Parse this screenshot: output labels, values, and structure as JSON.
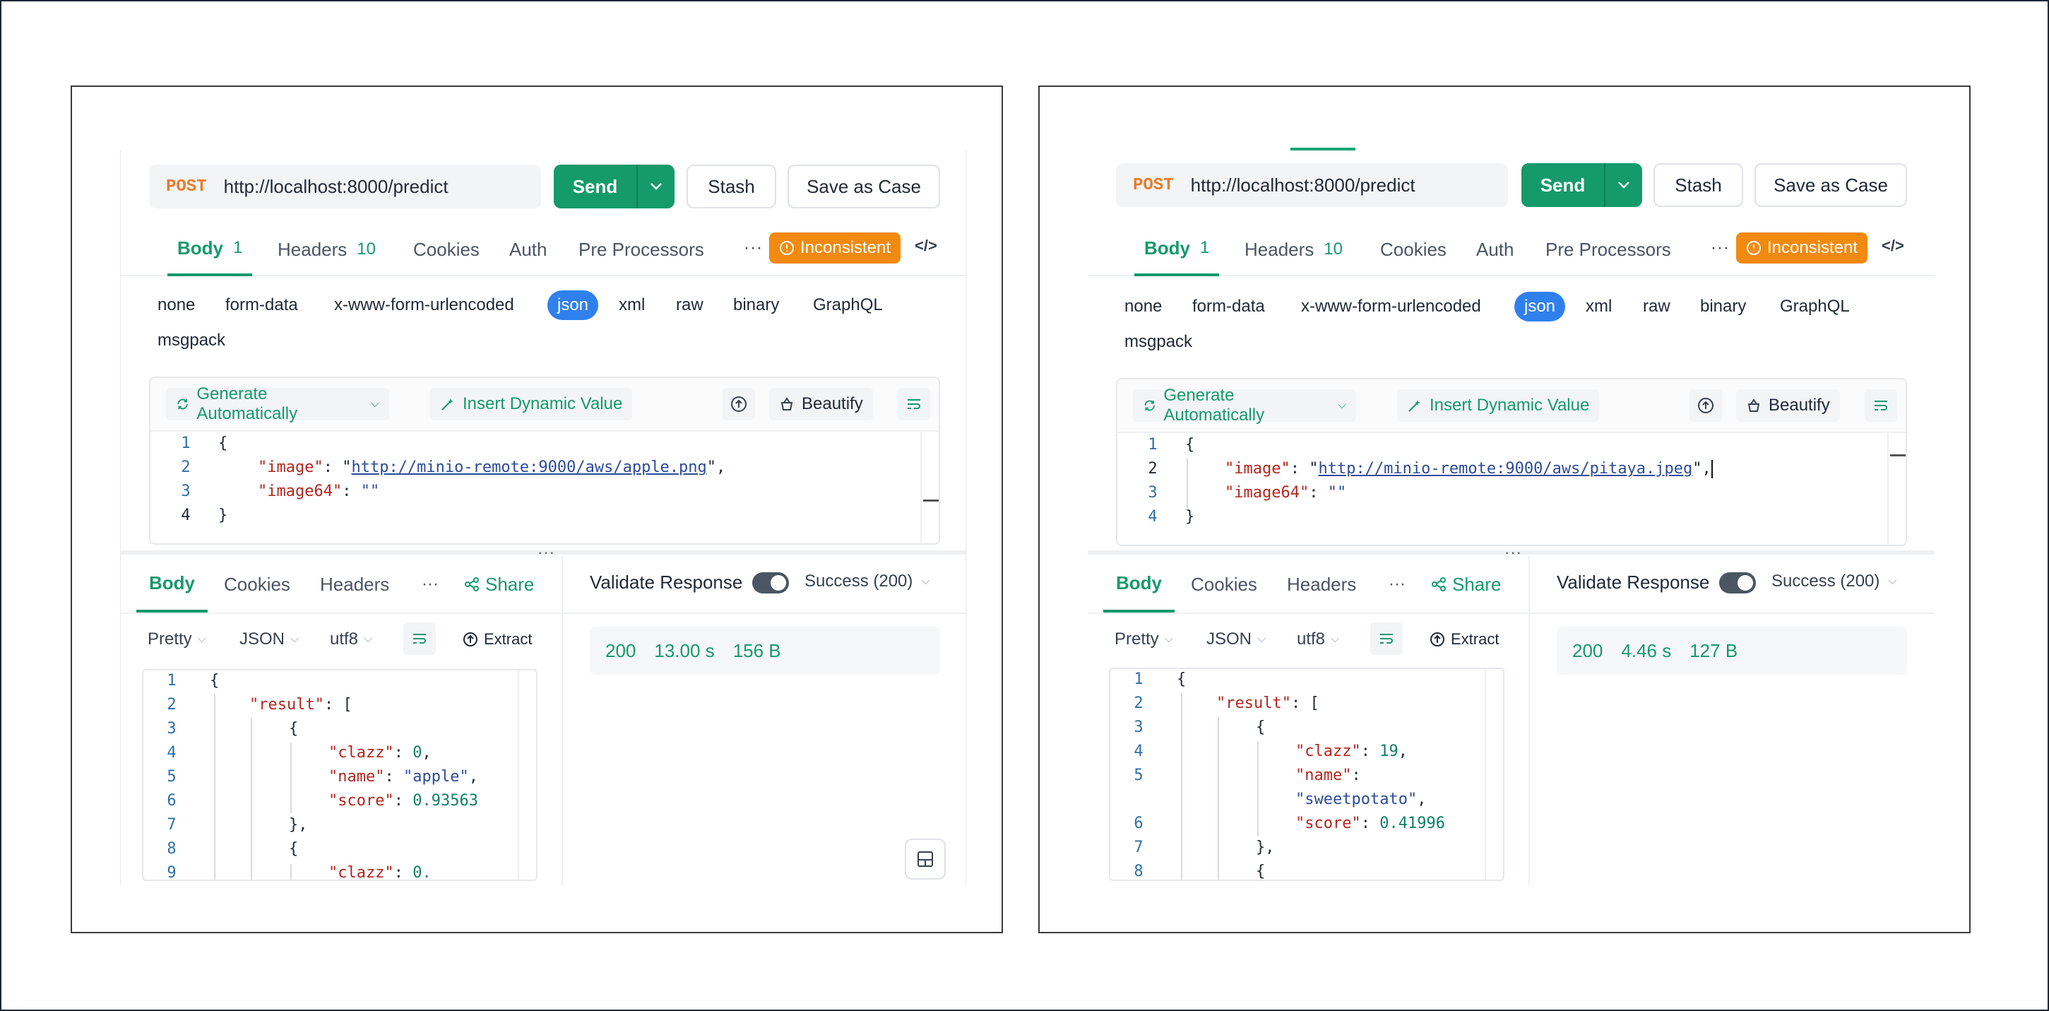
{
  "left": {
    "request": {
      "method": "POST",
      "url": "http://localhost:8000/predict",
      "send_label": "Send",
      "stash_label": "Stash",
      "save_as_case_label": "Save as Case"
    },
    "tabs": [
      {
        "label": "Body",
        "count": "1"
      },
      {
        "label": "Headers",
        "count": "10"
      },
      {
        "label": "Cookies"
      },
      {
        "label": "Auth"
      },
      {
        "label": "Pre Processors"
      }
    ],
    "more_label": "···",
    "inconsistent_label": "Inconsistent",
    "code_icon": "</>",
    "body_types": [
      "none",
      "form-data",
      "x-www-form-urlencoded",
      "json",
      "xml",
      "raw",
      "binary",
      "GraphQL",
      "msgpack"
    ],
    "editor_toolbar": {
      "generate_label": "Generate Automatically",
      "insert_label": "Insert Dynamic Value",
      "beautify_label": "Beautify"
    },
    "request_code": {
      "line_numbers": [
        "1",
        "2",
        "3",
        "4"
      ],
      "open_brace": "{",
      "close_brace": "}",
      "k_image": "\"image\"",
      "v_image": "http://minio-remote:9000/aws/apple.png",
      "k_image64": "\"image64\"",
      "v_image64": "\"\""
    },
    "response": {
      "tabs": [
        "Body",
        "Cookies",
        "Headers"
      ],
      "share_label": "Share",
      "pretty_label": "Pretty",
      "json_label": "JSON",
      "encoding_label": "utf8",
      "extract_label": "Extract",
      "validate_label": "Validate Response",
      "success_label": "Success (200)",
      "status": "200",
      "time": "13.00 s",
      "size": "156 B",
      "line_numbers": [
        "1",
        "2",
        "3",
        "4",
        "5",
        "6",
        "7",
        "8",
        "9"
      ],
      "k_result": "\"result\"",
      "k_clazz": "\"clazz\"",
      "v_clazz": "0",
      "k_name": "\"name\"",
      "v_name": "\"apple\"",
      "k_score": "\"score\"",
      "v_score": "0.93563",
      "v_clazz2": "0."
    }
  },
  "right": {
    "request": {
      "method": "POST",
      "url": "http://localhost:8000/predict",
      "send_label": "Send",
      "stash_label": "Stash",
      "save_as_case_label": "Save as Case"
    },
    "tabs": [
      {
        "label": "Body",
        "count": "1"
      },
      {
        "label": "Headers",
        "count": "10"
      },
      {
        "label": "Cookies"
      },
      {
        "label": "Auth"
      },
      {
        "label": "Pre Processors"
      }
    ],
    "more_label": "···",
    "inconsistent_label": "Inconsistent",
    "code_icon": "</>",
    "body_types": [
      "none",
      "form-data",
      "x-www-form-urlencoded",
      "json",
      "xml",
      "raw",
      "binary",
      "GraphQL",
      "msgpack"
    ],
    "editor_toolbar": {
      "generate_label": "Generate Automatically",
      "insert_label": "Insert Dynamic Value",
      "beautify_label": "Beautify"
    },
    "request_code": {
      "line_numbers": [
        "1",
        "2",
        "3",
        "4"
      ],
      "open_brace": "{",
      "close_brace": "}",
      "k_image": "\"image\"",
      "v_image": "http://minio-remote:9000/aws/pitaya.jpeg",
      "k_image64": "\"image64\"",
      "v_image64": "\"\""
    },
    "response": {
      "tabs": [
        "Body",
        "Cookies",
        "Headers"
      ],
      "share_label": "Share",
      "pretty_label": "Pretty",
      "json_label": "JSON",
      "encoding_label": "utf8",
      "extract_label": "Extract",
      "validate_label": "Validate Response",
      "success_label": "Success (200)",
      "status": "200",
      "time": "4.46 s",
      "size": "127 B",
      "line_numbers": [
        "1",
        "2",
        "3",
        "4",
        "5",
        "6",
        "7",
        "8"
      ],
      "k_result": "\"result\"",
      "k_clazz": "\"clazz\"",
      "v_clazz": "19",
      "k_name": "\"name\"",
      "v_name": "\"sweetpotato\"",
      "k_score": "\"score\"",
      "v_score": "0.41996"
    }
  },
  "colors": {
    "accent": "#159a6b",
    "method": "#ea7b2a",
    "warning": "#f28a0f",
    "selected_type": "#2f80ed"
  },
  "icons": [
    "chevron-down-icon",
    "warning-icon",
    "code-icon",
    "refresh-icon",
    "wand-icon",
    "upload-icon",
    "beautify-icon",
    "wrap-icon",
    "share-icon",
    "extract-icon",
    "layout-icon"
  ]
}
